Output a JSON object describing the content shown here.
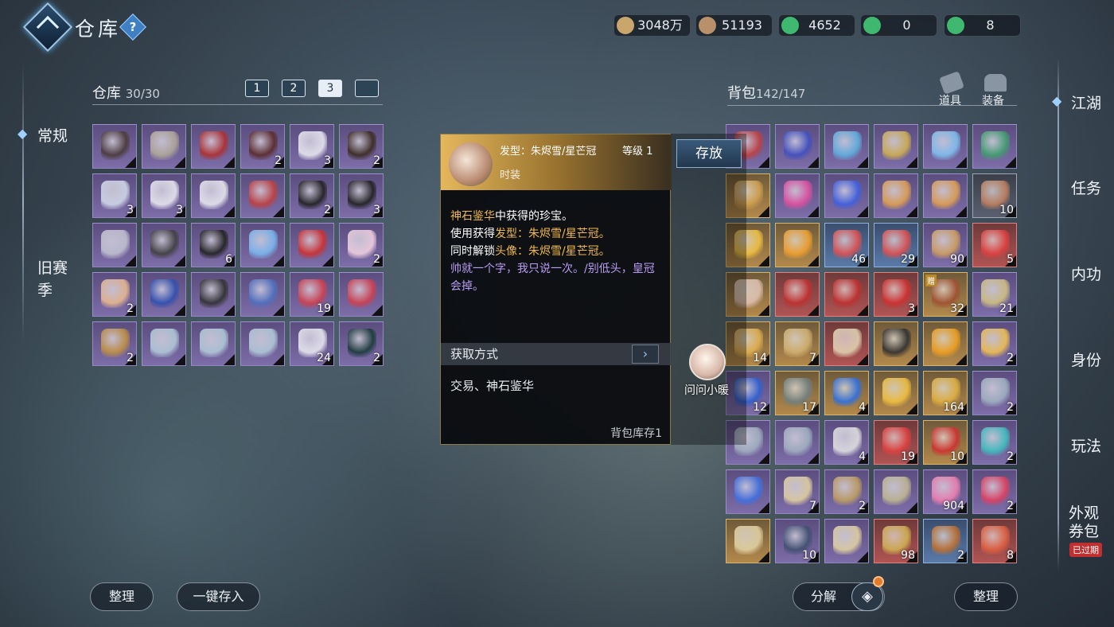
{
  "header": {
    "title": "仓库",
    "help": "?"
  },
  "currencies": [
    {
      "value": "3048万",
      "color": "#c9a66b"
    },
    {
      "value": "51193",
      "color": "#b8906a"
    },
    {
      "value": "4652",
      "color": "#3fb870"
    },
    {
      "value": "0",
      "color": "#3fb870"
    },
    {
      "value": "8",
      "color": "#3fb870"
    }
  ],
  "left_nav": {
    "active": "常规",
    "items": [
      "常规",
      "旧赛",
      "季"
    ]
  },
  "warehouse": {
    "title": "仓库",
    "count": "30/30",
    "tabs": [
      "1",
      "2",
      "3",
      ""
    ],
    "slots": [
      {
        "c": "",
        "t": "",
        "col": "#4a3a3a"
      },
      {
        "c": "",
        "t": "",
        "col": "#b0a898"
      },
      {
        "c": "",
        "t": "",
        "col": "#b03030"
      },
      {
        "c": "2",
        "t": "",
        "col": "#5a2a2a"
      },
      {
        "c": "3",
        "t": "",
        "col": "#e8e8f0"
      },
      {
        "c": "2",
        "t": "",
        "col": "#3a2a20"
      },
      {
        "c": "3",
        "t": "",
        "col": "#d0d8e8"
      },
      {
        "c": "3",
        "t": "",
        "col": "#e8e8f0"
      },
      {
        "c": "",
        "t": "",
        "col": "#e8e8f0"
      },
      {
        "c": "",
        "t": "",
        "col": "#c04040"
      },
      {
        "c": "2",
        "t": "",
        "col": "#202020"
      },
      {
        "c": "3",
        "t": "",
        "col": "#202020"
      },
      {
        "c": "",
        "t": "",
        "col": "#c0c0d0"
      },
      {
        "c": "",
        "t": "",
        "col": "#404040"
      },
      {
        "c": "6",
        "t": "",
        "col": "#202020"
      },
      {
        "c": "",
        "t": "",
        "col": "#7ab8f0"
      },
      {
        "c": "",
        "t": "",
        "col": "#d03030"
      },
      {
        "c": "2",
        "t": "",
        "col": "#f0d0e0"
      },
      {
        "c": "2",
        "t": "",
        "col": "#e8b890"
      },
      {
        "c": "",
        "t": "",
        "col": "#3050b0"
      },
      {
        "c": "",
        "t": "",
        "col": "#303030"
      },
      {
        "c": "",
        "t": "",
        "col": "#5070c0"
      },
      {
        "c": "19",
        "t": "",
        "col": "#d04050"
      },
      {
        "c": "",
        "t": "",
        "col": "#d04050"
      },
      {
        "c": "2",
        "t": "",
        "col": "#c09040"
      },
      {
        "c": "",
        "t": "",
        "col": "#b0c8d8"
      },
      {
        "c": "",
        "t": "",
        "col": "#b0c8d8"
      },
      {
        "c": "",
        "t": "",
        "col": "#b0c8d8"
      },
      {
        "c": "24",
        "t": "",
        "col": "#e8e8f0"
      },
      {
        "c": "2",
        "t": "",
        "col": "#1a3a3a"
      }
    ],
    "buttons": {
      "sort": "整理",
      "deposit_all": "一键存入"
    }
  },
  "bag": {
    "title": "背包",
    "count": "142/147",
    "tabs": [
      "道具",
      "装备"
    ],
    "slots": [
      {
        "c": "",
        "t": "",
        "k": "purple",
        "col": "#c04040"
      },
      {
        "c": "",
        "t": "",
        "k": "purple",
        "col": "#4050c0"
      },
      {
        "c": "",
        "t": "",
        "k": "purple",
        "col": "#60b0e0"
      },
      {
        "c": "",
        "t": "",
        "k": "purple",
        "col": "#d0b050"
      },
      {
        "c": "",
        "t": "",
        "k": "purple",
        "col": "#80c0f0"
      },
      {
        "c": "",
        "t": "",
        "k": "purple",
        "col": "#40a070"
      },
      {
        "c": "",
        "t": "",
        "k": "gold",
        "col": "#d0a050"
      },
      {
        "c": "",
        "t": "",
        "k": "purple",
        "col": "#e050a0"
      },
      {
        "c": "",
        "t": "",
        "k": "purple",
        "col": "#4060e0"
      },
      {
        "c": "",
        "t": "",
        "k": "purple",
        "col": "#e0a050"
      },
      {
        "c": "",
        "t": "",
        "k": "purple",
        "col": "#e0a050"
      },
      {
        "c": "10",
        "t": "",
        "k": "dark",
        "col": "#c08060"
      },
      {
        "c": "",
        "t": "",
        "k": "gold",
        "col": "#f0c040"
      },
      {
        "c": "",
        "t": "",
        "k": "gold",
        "col": "#f0a030"
      },
      {
        "c": "46",
        "t": "",
        "k": "blue",
        "col": "#e05050"
      },
      {
        "c": "29",
        "t": "",
        "k": "blue",
        "col": "#e05050"
      },
      {
        "c": "90",
        "t": "",
        "k": "purple",
        "col": "#d0a060"
      },
      {
        "c": "5",
        "t": "",
        "k": "red",
        "col": "#e04040"
      },
      {
        "c": "",
        "t": "",
        "k": "gold",
        "col": "#e0c0b0"
      },
      {
        "c": "",
        "t": "",
        "k": "red",
        "col": "#c03030"
      },
      {
        "c": "",
        "t": "",
        "k": "red",
        "col": "#c03030"
      },
      {
        "c": "3",
        "t": "",
        "k": "red",
        "col": "#d03030"
      },
      {
        "c": "32",
        "t": "赠",
        "k": "gold",
        "col": "#a05030"
      },
      {
        "c": "21",
        "t": "",
        "k": "purple",
        "col": "#d0c080"
      },
      {
        "c": "14",
        "t": "",
        "k": "gold",
        "col": "#e0b050"
      },
      {
        "c": "7",
        "t": "",
        "k": "gold",
        "col": "#d0b070"
      },
      {
        "c": "",
        "t": "",
        "k": "red",
        "col": "#e0d0b0"
      },
      {
        "c": "",
        "t": "",
        "k": "gold",
        "col": "#303030"
      },
      {
        "c": "",
        "t": "",
        "k": "gold",
        "col": "#f0a020"
      },
      {
        "c": "2",
        "t": "",
        "k": "purple",
        "col": "#f0c050"
      },
      {
        "c": "12",
        "t": "",
        "k": "purple",
        "col": "#3060d0"
      },
      {
        "c": "17",
        "t": "",
        "k": "gold",
        "col": "#708080"
      },
      {
        "c": "4",
        "t": "",
        "k": "gold",
        "col": "#3070e0"
      },
      {
        "c": "",
        "t": "",
        "k": "gold",
        "col": "#f0c040"
      },
      {
        "c": "164",
        "t": "",
        "k": "gold",
        "col": "#e0b040"
      },
      {
        "c": "2",
        "t": "",
        "k": "purple",
        "col": "#a0b0c0"
      },
      {
        "c": "",
        "t": "",
        "k": "purple",
        "col": "#a0b0c0"
      },
      {
        "c": "",
        "t": "",
        "k": "purple",
        "col": "#a0b0c0"
      },
      {
        "c": "4",
        "t": "",
        "k": "purple",
        "col": "#e0e0e0"
      },
      {
        "c": "19",
        "t": "",
        "k": "red",
        "col": "#e04040"
      },
      {
        "c": "10",
        "t": "",
        "k": "gold",
        "col": "#d03030"
      },
      {
        "c": "2",
        "t": "",
        "k": "purple",
        "col": "#40c0c0"
      },
      {
        "c": "",
        "t": "",
        "k": "purple",
        "col": "#4070e0"
      },
      {
        "c": "7",
        "t": "",
        "k": "purple",
        "col": "#e0d0a0"
      },
      {
        "c": "2",
        "t": "",
        "k": "purple",
        "col": "#c0a060"
      },
      {
        "c": "",
        "t": "",
        "k": "purple",
        "col": "#c0b890"
      },
      {
        "c": "904",
        "t": "",
        "k": "purple",
        "col": "#f080b0"
      },
      {
        "c": "2",
        "t": "",
        "k": "purple",
        "col": "#e04060"
      },
      {
        "c": "",
        "t": "",
        "k": "gold",
        "col": "#e0d0a0"
      },
      {
        "c": "10",
        "t": "",
        "k": "purple",
        "col": "#405070"
      },
      {
        "c": "",
        "t": "",
        "k": "purple",
        "col": "#e0d0a0"
      },
      {
        "c": "98",
        "t": "",
        "k": "red",
        "col": "#d0b050"
      },
      {
        "c": "2",
        "t": "",
        "k": "blue",
        "col": "#c07030"
      },
      {
        "c": "8",
        "t": "",
        "k": "red",
        "col": "#e06040"
      }
    ],
    "buttons": {
      "decompose": "分解",
      "sort": "整理"
    }
  },
  "right_nav": {
    "items": [
      "江湖",
      "任务",
      "内功",
      "身份",
      "玩法",
      "外观\n券包"
    ],
    "expired": "已过期"
  },
  "tooltip": {
    "item_label": "发型：朱烬雪/星芒冠",
    "level": "等级 1",
    "type": "时装",
    "desc_gold1": "神石鉴华",
    "desc1": "中获得的珍宝。",
    "desc2a": "使用获得",
    "desc2b": "发型：",
    "desc2c": "朱烬雪/星芒冠。",
    "desc3a": "同时解锁",
    "desc3b": "头像：",
    "desc3c": "朱烬雪/星芒冠。",
    "desc4": "帅就一个字，我只说一次。/别低头，皇冠会掉。",
    "section": "获取方式",
    "acquire": "交易、神石鉴华",
    "stock": "背包库存1"
  },
  "store_button": "存放",
  "assistant": {
    "label": "问问小暖"
  }
}
